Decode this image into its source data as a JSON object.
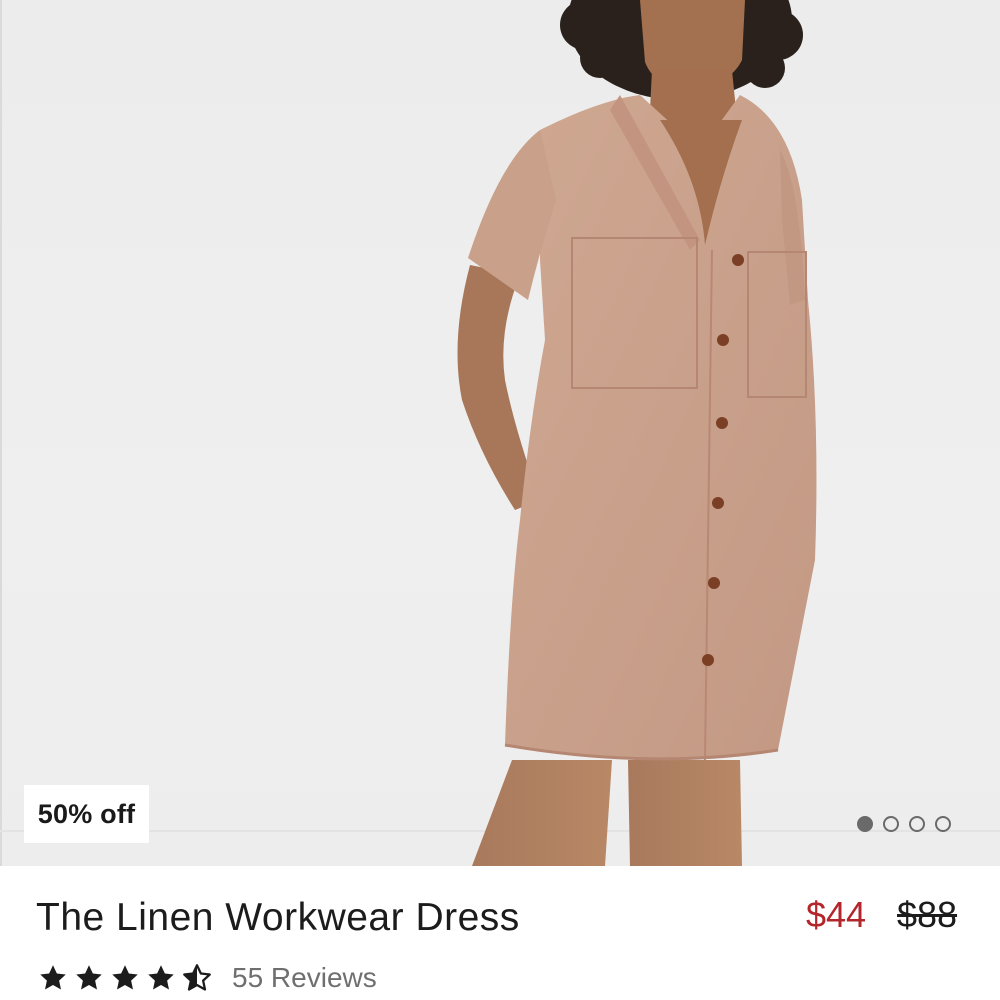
{
  "product": {
    "badge": "50% off",
    "title": "The Linen Workwear Dress",
    "sale_price": "$44",
    "original_price": "$88",
    "rating": 4.5,
    "rating_max": 5,
    "review_count_label": "55 Reviews"
  },
  "carousel": {
    "total_slides": 4,
    "active_index": 0
  },
  "colors": {
    "sale_price": "#b3262b",
    "dress": "#c9a08a",
    "background": "#ededed"
  },
  "image": {
    "alt": "Model wearing The Linen Workwear Dress"
  }
}
